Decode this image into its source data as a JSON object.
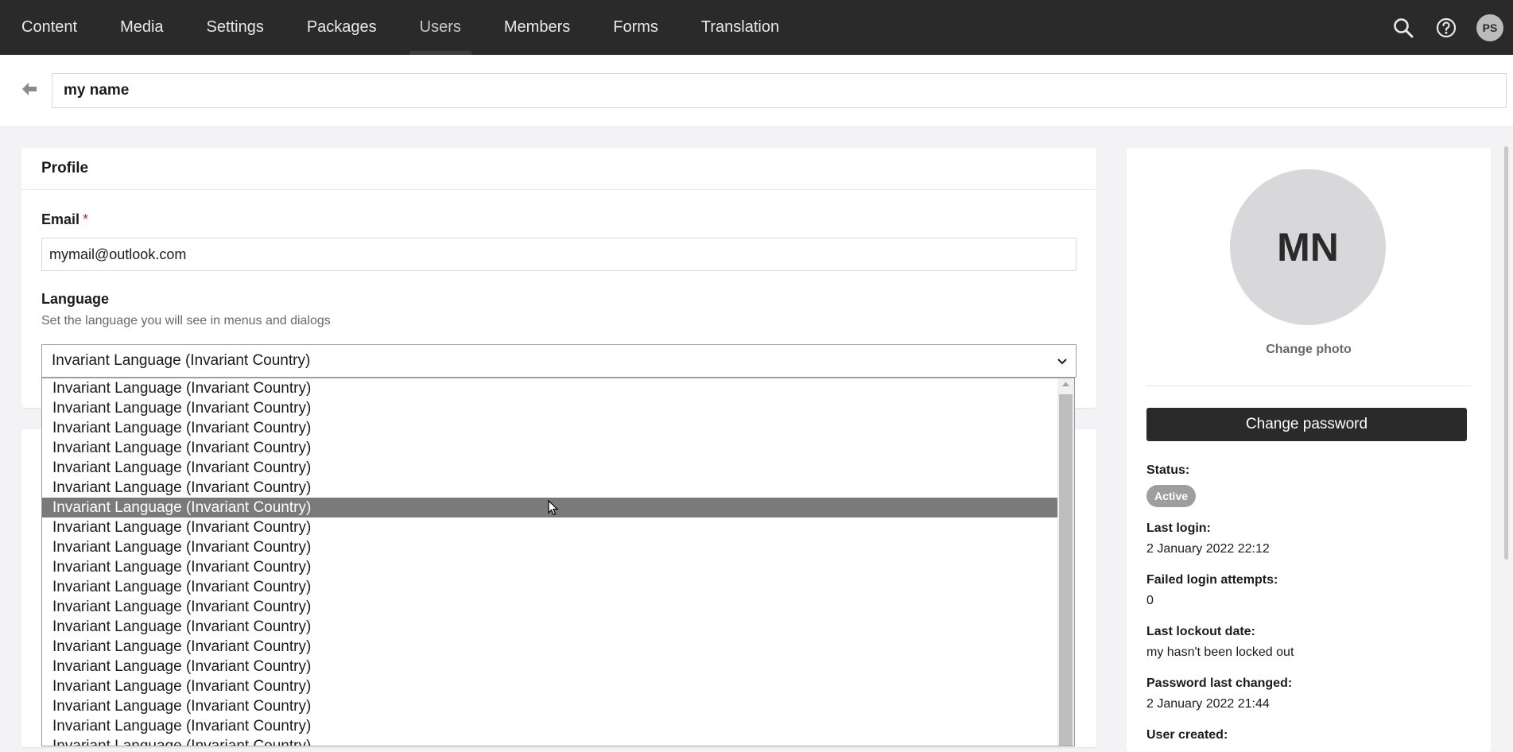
{
  "nav": {
    "sections": [
      {
        "label": "Content",
        "active": false
      },
      {
        "label": "Media",
        "active": false
      },
      {
        "label": "Settings",
        "active": false
      },
      {
        "label": "Packages",
        "active": false
      },
      {
        "label": "Users",
        "active": true
      },
      {
        "label": "Members",
        "active": false
      },
      {
        "label": "Forms",
        "active": false
      },
      {
        "label": "Translation",
        "active": false
      }
    ],
    "user_initials": "PS"
  },
  "header": {
    "name_value": "my name"
  },
  "profile": {
    "title": "Profile",
    "email_label": "Email",
    "required_marker": "*",
    "email_value": "mymail@outlook.com",
    "language_label": "Language",
    "language_desc": "Set the language you will see in menus and dialogs",
    "language_selected": "Invariant Language (Invariant Country)"
  },
  "dropdown": {
    "option_label": "Invariant Language (Invariant Country)",
    "option_count": 19,
    "hovered_index": 6
  },
  "side": {
    "avatar_initials": "MN",
    "change_photo": "Change photo",
    "change_password": "Change password",
    "status_label": "Status:",
    "status_value": "Active",
    "last_login_label": "Last login:",
    "last_login_value": "2 January 2022 22:12",
    "failed_label": "Failed login attempts:",
    "failed_value": "0",
    "lockout_label": "Last lockout date:",
    "lockout_value": "my hasn't been locked out",
    "pw_changed_label": "Password last changed:",
    "pw_changed_value": "2 January 2022 21:44",
    "created_label": "User created:"
  },
  "colors": {
    "topbar": "#2a2a2a",
    "button_dark": "#2a2a2a",
    "badge": "#9e9e9e",
    "hover_option": "#7a7a7a"
  }
}
